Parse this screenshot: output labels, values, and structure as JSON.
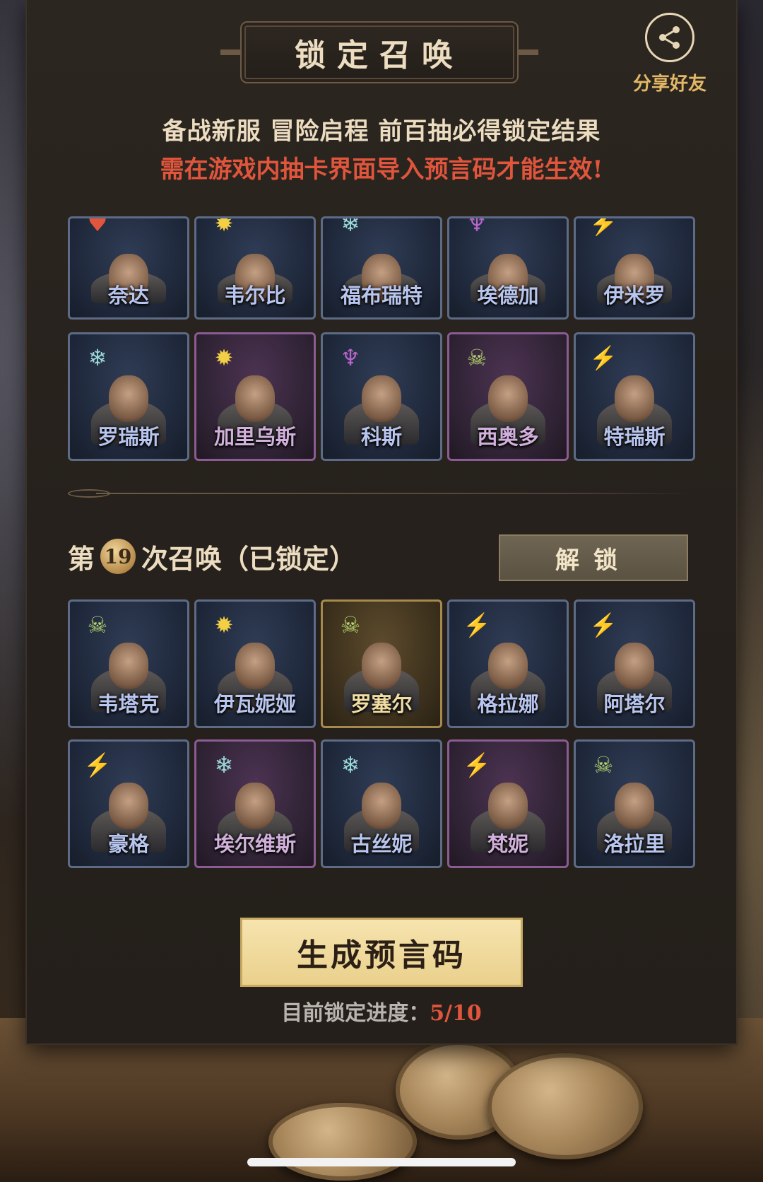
{
  "header": {
    "title": "锁定召唤",
    "share_label": "分享好友"
  },
  "subtitle": "备战新服 冒险启程 前百抽必得锁定结果",
  "warning": "需在游戏内抽卡界面导入预言码才能生效!",
  "top_grid": [
    {
      "name": "奈达",
      "element": "fire-icon",
      "rarity": "blue"
    },
    {
      "name": "韦尔比",
      "element": "sun-icon",
      "rarity": "blue"
    },
    {
      "name": "福布瑞特",
      "element": "frost-icon",
      "rarity": "blue"
    },
    {
      "name": "埃德加",
      "element": "demon-icon",
      "rarity": "blue"
    },
    {
      "name": "伊米罗",
      "element": "bolt-icon",
      "rarity": "blue"
    },
    {
      "name": "罗瑞斯",
      "element": "frost-icon",
      "rarity": "blue"
    },
    {
      "name": "加里乌斯",
      "element": "sun-icon",
      "rarity": "purple"
    },
    {
      "name": "科斯",
      "element": "demon-icon",
      "rarity": "blue"
    },
    {
      "name": "西奥多",
      "element": "skull-icon",
      "rarity": "purple"
    },
    {
      "name": "特瑞斯",
      "element": "bolt-icon",
      "rarity": "blue"
    }
  ],
  "round": {
    "prefix": "第",
    "number": "19",
    "suffix": "次召唤（已锁定）",
    "unlock_label": "解锁"
  },
  "bottom_grid": [
    {
      "name": "韦塔克",
      "element": "skull-icon",
      "rarity": "blue"
    },
    {
      "name": "伊瓦妮娅",
      "element": "sun-icon",
      "rarity": "blue"
    },
    {
      "name": "罗塞尔",
      "element": "skull-icon",
      "rarity": "gold"
    },
    {
      "name": "格拉娜",
      "element": "bolt-icon",
      "rarity": "blue"
    },
    {
      "name": "阿塔尔",
      "element": "bolt-icon",
      "rarity": "blue"
    },
    {
      "name": "豪格",
      "element": "bolt-icon",
      "rarity": "blue"
    },
    {
      "name": "埃尔维斯",
      "element": "frost-icon",
      "rarity": "purple"
    },
    {
      "name": "古丝妮",
      "element": "frost-icon",
      "rarity": "blue"
    },
    {
      "name": "梵妮",
      "element": "bolt-icon",
      "rarity": "purple"
    },
    {
      "name": "洛拉里",
      "element": "skull-icon",
      "rarity": "blue"
    }
  ],
  "generate_label": "生成预言码",
  "progress": {
    "label": "目前锁定进度：",
    "value": "5/10"
  }
}
